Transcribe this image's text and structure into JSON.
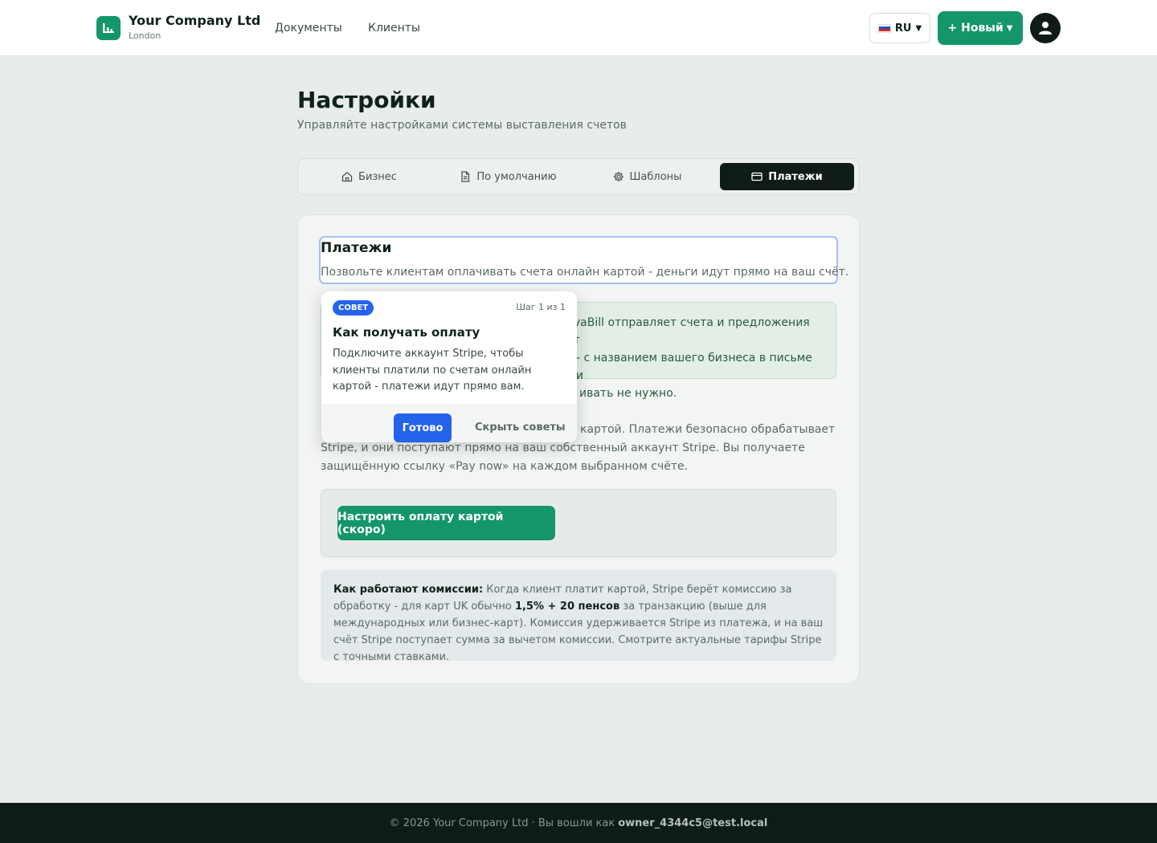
{
  "header": {
    "company_name": "Your Company Ltd",
    "company_city": "London",
    "nav": [
      "Документы",
      "Клиенты"
    ],
    "language": "RU",
    "new_button": "+ Новый",
    "logo_icon": "chart-bar-icon",
    "avatar_icon": "user-icon"
  },
  "page": {
    "title": "Настройки",
    "subtitle": "Управляйте настройками системы выставления счетов"
  },
  "tabs": [
    {
      "label": "Бизнес",
      "icon": "home-icon",
      "active": false
    },
    {
      "label": "По умолчанию",
      "icon": "document-icon",
      "active": false
    },
    {
      "label": "Шаблоны",
      "icon": "gear-icon",
      "active": false
    },
    {
      "label": "Платежи",
      "icon": "credit-card-icon",
      "active": true
    }
  ],
  "payments": {
    "title": "Платежи",
    "description": "Позвольте клиентам оплачивать счета онлайн картой - деньги идут прямо на ваш счёт.",
    "green_note_lines": [
      "gvaBill отправляет счета и предложения от",
      "- с названием вашего бизнеса в письме и",
      "ивать не нужно."
    ],
    "body_lines": [
      "картой. Платежи безопасно обрабатывает",
      "Stripe, и они поступают прямо на ваш собственный аккаунт Stripe. Вы получаете",
      "защищённую ссылку «Pay now» на каждом выбранном счёте."
    ],
    "setup_button": "Настроить оплату картой (скоро)",
    "fees": {
      "label": "Как работают комиссии:",
      "text_1": " Когда клиент платит картой, Stripe берёт комиссию за обработку - для карт UK обычно ",
      "rate": "1,5% + 20 пенсов",
      "text_2": " за транзакцию (выше для международных или бизнес-карт). Комиссия удерживается Stripe из платежа, и на ваш счёт Stripe поступает сумма за вычетом комиссии. Смотрите актуальные тарифы Stripe с точными ставками."
    }
  },
  "tooltip": {
    "badge": "СОВЕТ",
    "step": "Шаг 1 из 1",
    "title": "Как получать оплату",
    "text": "Подключите аккаунт Stripe, чтобы клиенты платили по счетам онлайн картой - платежи идут прямо вам.",
    "done_button": "Готово",
    "hide_button": "Скрыть советы"
  },
  "footer": {
    "copyright": "© 2026 Your Company Ltd · Вы вошли как",
    "email": "owner_4344c5@test.local"
  },
  "colors": {
    "brand": "#14956b",
    "accent_blue": "#2563eb",
    "dark": "#0f1b15"
  }
}
